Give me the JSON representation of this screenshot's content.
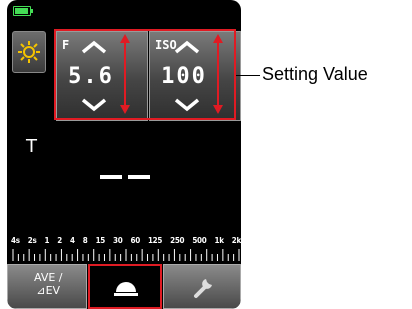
{
  "status": {
    "battery": "battery-full-icon"
  },
  "mode_button": {
    "icon": "sun-icon"
  },
  "aperture": {
    "label": "F",
    "value": "5.6"
  },
  "iso": {
    "label": "ISO",
    "value": "100"
  },
  "callout": {
    "text": "Setting Value"
  },
  "measure": {
    "mode_letter": "T",
    "reading": "--"
  },
  "shutter_scale": [
    "4s",
    "2s",
    "1",
    "2",
    "4",
    "8",
    "15",
    "30",
    "60",
    "125",
    "250",
    "500",
    "1k",
    "2k"
  ],
  "bottom": {
    "ave_label_line1": "AVE /",
    "ave_label_line2": "⊿EV"
  },
  "colors": {
    "highlight": "#e01b23",
    "battery": "#44dd55"
  }
}
